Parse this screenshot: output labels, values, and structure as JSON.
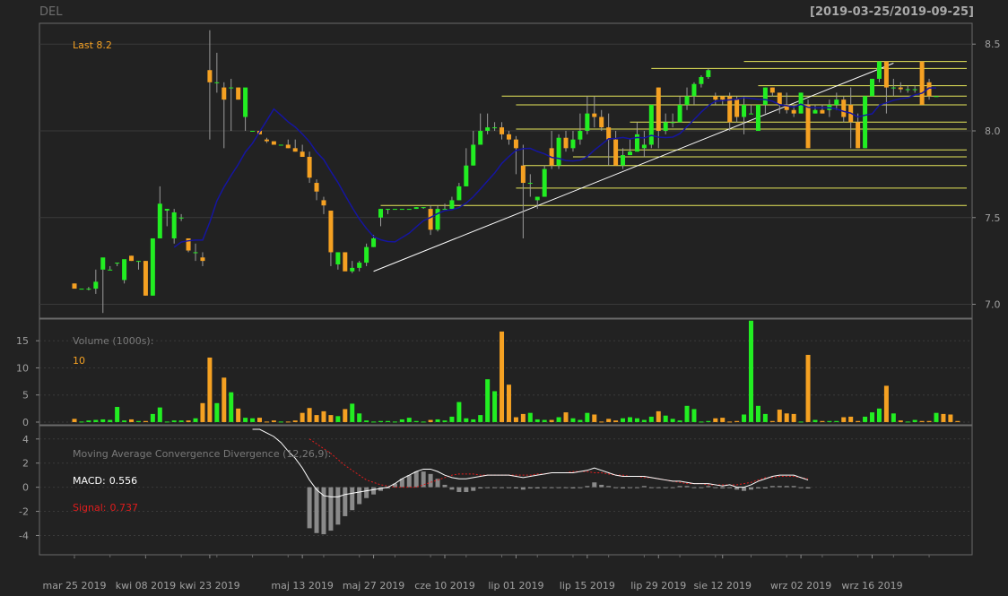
{
  "header": {
    "ticker": "DEL",
    "date_range": "[2019-03-25/2019-09-25]"
  },
  "colors": {
    "background": "#222222",
    "up": "#22ee22",
    "down": "#f5a122",
    "sma": "#1515a0",
    "level_line": "#e6e65a",
    "trend_line": "#ffffff",
    "macd": "#ffffff",
    "signal": "#e01c1c",
    "histogram": "#8a8a8a",
    "grid": "#3a3a3a",
    "text": "#a0a0a0"
  },
  "chart_data": [
    {
      "type": "candlestick",
      "name": "price",
      "last_label": "Last 8.2",
      "y_ticks": [
        "7.0",
        "7.5",
        "8.0",
        "8.5"
      ],
      "ylim": [
        6.92,
        8.62
      ],
      "x_tick_labels": [
        "mar 25 2019",
        "kwi 08 2019",
        "kwi 23 2019",
        "maj 13 2019",
        "maj 27 2019",
        "cze 10 2019",
        "lip 01 2019",
        "lip 15 2019",
        "lip 29 2019",
        "sie 12 2019",
        "wrz 02 2019",
        "wrz 16 2019"
      ],
      "x_tick_index": [
        0,
        10,
        19,
        32,
        42,
        52,
        62,
        72,
        82,
        91,
        102,
        112
      ],
      "candles": [
        {
          "o": 7.12,
          "h": 7.12,
          "l": 7.1,
          "c": 7.09
        },
        {
          "o": 7.09,
          "h": 7.09,
          "l": 7.09,
          "c": 7.09
        },
        {
          "o": 7.09,
          "h": 7.1,
          "l": 7.08,
          "c": 7.09
        },
        {
          "o": 7.09,
          "h": 7.2,
          "l": 7.06,
          "c": 7.13
        },
        {
          "o": 7.2,
          "h": 7.2,
          "l": 6.95,
          "c": 7.27
        },
        {
          "o": 7.2,
          "h": 7.22,
          "l": 7.2,
          "c": 7.2
        },
        {
          "o": 7.24,
          "h": 7.24,
          "l": 7.22,
          "c": 7.24
        },
        {
          "o": 7.14,
          "h": 7.22,
          "l": 7.12,
          "c": 7.26
        },
        {
          "o": 7.28,
          "h": 7.28,
          "l": 7.25,
          "c": 7.25
        },
        {
          "o": 7.25,
          "h": 7.25,
          "l": 7.2,
          "c": 7.25
        },
        {
          "o": 7.25,
          "h": 7.25,
          "l": 7.05,
          "c": 7.05
        },
        {
          "o": 7.05,
          "h": 7.2,
          "l": 7.05,
          "c": 7.38
        },
        {
          "o": 7.38,
          "h": 7.68,
          "l": 7.38,
          "c": 7.58
        },
        {
          "o": 7.54,
          "h": 7.55,
          "l": 7.45,
          "c": 7.55
        },
        {
          "o": 7.38,
          "h": 7.55,
          "l": 7.35,
          "c": 7.53
        },
        {
          "o": 7.5,
          "h": 7.52,
          "l": 7.48,
          "c": 7.5
        },
        {
          "o": 7.38,
          "h": 7.38,
          "l": 7.3,
          "c": 7.31
        },
        {
          "o": 7.3,
          "h": 7.35,
          "l": 7.25,
          "c": 7.3
        },
        {
          "o": 7.27,
          "h": 7.3,
          "l": 7.22,
          "c": 7.25
        },
        {
          "o": 8.35,
          "h": 8.58,
          "l": 7.95,
          "c": 8.28
        },
        {
          "o": 8.28,
          "h": 8.45,
          "l": 8.22,
          "c": 8.28
        },
        {
          "o": 8.25,
          "h": 8.28,
          "l": 7.9,
          "c": 8.18
        },
        {
          "o": 8.25,
          "h": 8.3,
          "l": 8.0,
          "c": 8.25
        },
        {
          "o": 8.25,
          "h": 8.25,
          "l": 8.18,
          "c": 8.18
        },
        {
          "o": 8.08,
          "h": 8.1,
          "l": 8.0,
          "c": 8.25
        },
        {
          "o": 8.0,
          "h": 8.0,
          "l": 8.0,
          "c": 8.0
        },
        {
          "o": 8.0,
          "h": 8.0,
          "l": 7.98,
          "c": 7.98
        },
        {
          "o": 7.95,
          "h": 7.96,
          "l": 7.93,
          "c": 7.94
        },
        {
          "o": 7.94,
          "h": 7.94,
          "l": 7.92,
          "c": 7.92
        },
        {
          "o": 7.92,
          "h": 7.92,
          "l": 7.92,
          "c": 7.92
        },
        {
          "o": 7.92,
          "h": 7.95,
          "l": 7.9,
          "c": 7.9
        },
        {
          "o": 7.9,
          "h": 7.95,
          "l": 7.88,
          "c": 7.88
        },
        {
          "o": 7.88,
          "h": 7.92,
          "l": 7.85,
          "c": 7.85
        },
        {
          "o": 7.85,
          "h": 7.88,
          "l": 7.7,
          "c": 7.73
        },
        {
          "o": 7.7,
          "h": 7.72,
          "l": 7.6,
          "c": 7.65
        },
        {
          "o": 7.6,
          "h": 7.62,
          "l": 7.52,
          "c": 7.57
        },
        {
          "o": 7.54,
          "h": 7.54,
          "l": 7.22,
          "c": 7.3
        },
        {
          "o": 7.23,
          "h": 7.3,
          "l": 7.2,
          "c": 7.3
        },
        {
          "o": 7.3,
          "h": 7.3,
          "l": 7.2,
          "c": 7.19
        },
        {
          "o": 7.19,
          "h": 7.25,
          "l": 7.18,
          "c": 7.21
        },
        {
          "o": 7.21,
          "h": 7.25,
          "l": 7.19,
          "c": 7.24
        },
        {
          "o": 7.24,
          "h": 7.35,
          "l": 7.22,
          "c": 7.33
        },
        {
          "o": 7.33,
          "h": 7.4,
          "l": 7.33,
          "c": 7.38
        },
        {
          "o": 7.5,
          "h": 7.55,
          "l": 7.45,
          "c": 7.55
        },
        {
          "o": 7.55,
          "h": 7.55,
          "l": 7.52,
          "c": 7.55
        },
        {
          "o": 7.55,
          "h": 7.55,
          "l": 7.55,
          "c": 7.55
        },
        {
          "o": 7.55,
          "h": 7.55,
          "l": 7.55,
          "c": 7.55
        },
        {
          "o": 7.55,
          "h": 7.55,
          "l": 7.55,
          "c": 7.55
        },
        {
          "o": 7.55,
          "h": 7.56,
          "l": 7.55,
          "c": 7.56
        },
        {
          "o": 7.56,
          "h": 7.56,
          "l": 7.55,
          "c": 7.56
        },
        {
          "o": 7.55,
          "h": 7.57,
          "l": 7.4,
          "c": 7.43
        },
        {
          "o": 7.43,
          "h": 7.57,
          "l": 7.42,
          "c": 7.55
        },
        {
          "o": 7.55,
          "h": 7.58,
          "l": 7.55,
          "c": 7.55
        },
        {
          "o": 7.55,
          "h": 7.62,
          "l": 7.55,
          "c": 7.6
        },
        {
          "o": 7.6,
          "h": 7.7,
          "l": 7.6,
          "c": 7.68
        },
        {
          "o": 7.68,
          "h": 7.9,
          "l": 7.68,
          "c": 7.8
        },
        {
          "o": 7.8,
          "h": 8.0,
          "l": 7.8,
          "c": 7.92
        },
        {
          "o": 7.92,
          "h": 8.1,
          "l": 7.92,
          "c": 8.0
        },
        {
          "o": 8.0,
          "h": 8.1,
          "l": 7.98,
          "c": 8.02
        },
        {
          "o": 8.02,
          "h": 8.05,
          "l": 8.0,
          "c": 8.02
        },
        {
          "o": 8.02,
          "h": 8.05,
          "l": 7.95,
          "c": 7.98
        },
        {
          "o": 7.98,
          "h": 8.0,
          "l": 7.92,
          "c": 7.95
        },
        {
          "o": 7.95,
          "h": 7.97,
          "l": 7.75,
          "c": 7.9
        },
        {
          "o": 7.8,
          "h": 7.92,
          "l": 7.38,
          "c": 7.7
        },
        {
          "o": 7.7,
          "h": 7.75,
          "l": 7.62,
          "c": 7.7
        },
        {
          "o": 7.6,
          "h": 7.62,
          "l": 7.55,
          "c": 7.62
        },
        {
          "o": 7.62,
          "h": 7.8,
          "l": 7.62,
          "c": 7.78
        },
        {
          "o": 7.9,
          "h": 8.0,
          "l": 7.78,
          "c": 7.8
        },
        {
          "o": 7.8,
          "h": 7.98,
          "l": 7.78,
          "c": 7.96
        },
        {
          "o": 7.96,
          "h": 8.0,
          "l": 7.88,
          "c": 7.9
        },
        {
          "o": 7.9,
          "h": 8.0,
          "l": 7.88,
          "c": 7.95
        },
        {
          "o": 7.95,
          "h": 8.1,
          "l": 7.92,
          "c": 8.0
        },
        {
          "o": 8.0,
          "h": 8.2,
          "l": 7.98,
          "c": 8.1
        },
        {
          "o": 8.1,
          "h": 8.2,
          "l": 8.02,
          "c": 8.08
        },
        {
          "o": 8.08,
          "h": 8.12,
          "l": 8.0,
          "c": 8.02
        },
        {
          "o": 8.02,
          "h": 8.1,
          "l": 7.8,
          "c": 7.95
        },
        {
          "o": 7.95,
          "h": 8.0,
          "l": 7.8,
          "c": 7.8
        },
        {
          "o": 7.8,
          "h": 7.9,
          "l": 7.78,
          "c": 7.86
        },
        {
          "o": 7.86,
          "h": 7.95,
          "l": 7.86,
          "c": 7.88
        },
        {
          "o": 7.88,
          "h": 8.05,
          "l": 7.88,
          "c": 7.98
        },
        {
          "o": 7.9,
          "h": 8.0,
          "l": 7.85,
          "c": 7.92
        },
        {
          "o": 7.92,
          "h": 8.15,
          "l": 7.9,
          "c": 8.15
        },
        {
          "o": 8.25,
          "h": 8.25,
          "l": 7.9,
          "c": 8.0
        },
        {
          "o": 8.0,
          "h": 8.1,
          "l": 7.98,
          "c": 8.05
        },
        {
          "o": 8.05,
          "h": 8.1,
          "l": 8.02,
          "c": 8.05
        },
        {
          "o": 8.05,
          "h": 8.2,
          "l": 8.05,
          "c": 8.15
        },
        {
          "o": 8.15,
          "h": 8.25,
          "l": 8.12,
          "c": 8.2
        },
        {
          "o": 8.2,
          "h": 8.28,
          "l": 8.15,
          "c": 8.27
        },
        {
          "o": 8.27,
          "h": 8.32,
          "l": 8.25,
          "c": 8.31
        },
        {
          "o": 8.31,
          "h": 8.36,
          "l": 8.3,
          "c": 8.35
        },
        {
          "o": 8.2,
          "h": 8.22,
          "l": 8.15,
          "c": 8.18
        },
        {
          "o": 8.2,
          "h": 8.2,
          "l": 8.15,
          "c": 8.18
        },
        {
          "o": 8.2,
          "h": 8.22,
          "l": 8.0,
          "c": 8.05
        },
        {
          "o": 8.18,
          "h": 8.2,
          "l": 8.05,
          "c": 8.08
        },
        {
          "o": 8.08,
          "h": 8.2,
          "l": 7.98,
          "c": 8.15
        },
        {
          "o": 8.1,
          "h": 8.15,
          "l": 8.1,
          "c": 8.1
        },
        {
          "o": 8.0,
          "h": 8.0,
          "l": 8.0,
          "c": 8.15
        },
        {
          "o": 8.15,
          "h": 8.25,
          "l": 8.1,
          "c": 8.25
        },
        {
          "o": 8.25,
          "h": 8.25,
          "l": 8.2,
          "c": 8.22
        },
        {
          "o": 8.22,
          "h": 8.22,
          "l": 8.1,
          "c": 8.15
        },
        {
          "o": 8.15,
          "h": 8.22,
          "l": 8.1,
          "c": 8.12
        },
        {
          "o": 8.12,
          "h": 8.15,
          "l": 8.08,
          "c": 8.1
        },
        {
          "o": 8.1,
          "h": 8.22,
          "l": 8.1,
          "c": 8.22
        },
        {
          "o": 8.15,
          "h": 8.18,
          "l": 7.9,
          "c": 7.9
        },
        {
          "o": 8.1,
          "h": 8.15,
          "l": 8.1,
          "c": 8.12
        },
        {
          "o": 8.12,
          "h": 8.15,
          "l": 8.1,
          "c": 8.1
        },
        {
          "o": 8.12,
          "h": 8.18,
          "l": 8.08,
          "c": 8.15
        },
        {
          "o": 8.15,
          "h": 8.22,
          "l": 8.12,
          "c": 8.18
        },
        {
          "o": 8.18,
          "h": 8.2,
          "l": 8.05,
          "c": 8.08
        },
        {
          "o": 8.15,
          "h": 8.25,
          "l": 7.9,
          "c": 8.05
        },
        {
          "o": 8.05,
          "h": 8.1,
          "l": 7.9,
          "c": 7.9
        },
        {
          "o": 7.9,
          "h": 8.2,
          "l": 7.9,
          "c": 8.2
        },
        {
          "o": 8.2,
          "h": 8.3,
          "l": 8.2,
          "c": 8.3
        },
        {
          "o": 8.3,
          "h": 8.4,
          "l": 8.28,
          "c": 8.4
        },
        {
          "o": 8.4,
          "h": 8.4,
          "l": 8.1,
          "c": 8.25
        },
        {
          "o": 8.25,
          "h": 8.3,
          "l": 8.2,
          "c": 8.25
        },
        {
          "o": 8.25,
          "h": 8.28,
          "l": 8.22,
          "c": 8.24
        },
        {
          "o": 8.24,
          "h": 8.26,
          "l": 8.22,
          "c": 8.24
        },
        {
          "o": 8.24,
          "h": 8.26,
          "l": 8.22,
          "c": 8.24
        },
        {
          "o": 8.4,
          "h": 8.4,
          "l": 8.15,
          "c": 8.15
        },
        {
          "o": 8.28,
          "h": 8.3,
          "l": 8.18,
          "c": 8.2
        },
        {
          "o": 8.2,
          "h": 8.2,
          "l": 8.2,
          "c": 8.2
        }
      ],
      "sma_start_index": 14,
      "horizontal_levels": [
        {
          "y": 8.4,
          "from": 94,
          "to": 124
        },
        {
          "y": 8.36,
          "from": 81,
          "to": 124
        },
        {
          "y": 8.26,
          "from": 96,
          "to": 124
        },
        {
          "y": 8.2,
          "from": 60,
          "to": 124
        },
        {
          "y": 8.15,
          "from": 62,
          "to": 124
        },
        {
          "y": 8.05,
          "from": 78,
          "to": 124
        },
        {
          "y": 8.01,
          "from": 62,
          "to": 124
        },
        {
          "y": 7.89,
          "from": 76,
          "to": 124
        },
        {
          "y": 7.85,
          "from": 70,
          "to": 124
        },
        {
          "y": 7.8,
          "from": 63,
          "to": 124
        },
        {
          "y": 7.67,
          "from": 62,
          "to": 124
        },
        {
          "y": 7.57,
          "from": 43,
          "to": 124
        }
      ],
      "trend_line": {
        "from_index": 42,
        "from_value": 7.19,
        "to_index": 115,
        "to_value": 8.39
      }
    },
    {
      "type": "bar",
      "name": "volume",
      "title": "Volume (1000s):",
      "last_value": "10",
      "y_ticks": [
        "0",
        "5",
        "10",
        "15"
      ],
      "ylim": [
        -0.5,
        19
      ],
      "values": [
        0.6,
        0.1,
        0.3,
        0.4,
        0.5,
        0.4,
        2.8,
        0.3,
        0.5,
        0.2,
        0.2,
        1.5,
        2.7,
        0.1,
        0.3,
        0.3,
        0.3,
        0.7,
        3.5,
        11.9,
        3.5,
        8.2,
        5.5,
        2.5,
        0.8,
        0.7,
        0.8,
        0.1,
        0.3,
        0.1,
        0.1,
        0.3,
        1.7,
        2.6,
        1.3,
        2.0,
        1.3,
        1.1,
        2.4,
        3.4,
        1.6,
        0.3,
        0.1,
        0.2,
        0.2,
        0.1,
        0.5,
        0.8,
        0.2,
        0.1,
        0.4,
        0.5,
        0.3,
        1.0,
        3.7,
        0.7,
        0.5,
        1.3,
        7.9,
        5.7,
        16.7,
        6.9,
        0.9,
        1.5,
        1.7,
        0.5,
        0.4,
        0.4,
        0.9,
        1.8,
        0.7,
        0.4,
        1.7,
        1.4,
        0.1,
        0.6,
        0.3,
        0.7,
        0.9,
        0.7,
        0.4,
        1.0,
        2.0,
        1.2,
        0.6,
        0.3,
        3.0,
        2.4,
        0.1,
        0.2,
        0.7,
        0.8,
        0.1,
        0.2,
        1.4,
        18.7,
        3.0,
        1.5,
        0.2,
        2.3,
        1.6,
        1.5,
        0.1,
        12.4,
        0.4,
        0.2,
        0.2,
        0.2,
        0.9,
        1.0,
        0.2,
        1.0,
        1.8,
        2.5,
        6.7,
        1.6,
        0.3,
        0.1,
        0.4,
        0.2,
        0.2,
        1.7,
        1.5,
        1.4,
        0.2
      ],
      "colors_note": "bar color follows candle direction"
    },
    {
      "type": "line",
      "name": "macd",
      "title": "Moving Average Convergence Divergence (12,26,9):",
      "macd_label": "MACD:",
      "macd_value": "0.556",
      "signal_label": "Signal:",
      "signal_value": "0.737",
      "y_ticks": [
        "4",
        "2",
        "0",
        "-2",
        "-4"
      ],
      "ylim": [
        -5.6,
        5.1
      ],
      "macd_start_index": 25,
      "signal_start_index": 33,
      "macd": [
        4.8,
        4.8,
        4.5,
        4.2,
        3.7,
        3.0,
        2.4,
        1.6,
        0.6,
        -0.2,
        -0.7,
        -0.8,
        -0.8,
        -0.6,
        -0.5,
        -0.4,
        -0.3,
        -0.2,
        -0.1,
        0.0,
        0.3,
        0.7,
        1.0,
        1.3,
        1.5,
        1.5,
        1.3,
        1.0,
        0.8,
        0.7,
        0.7,
        0.8,
        0.9,
        1.0,
        1.0,
        1.0,
        1.0,
        0.9,
        0.8,
        0.9,
        1.0,
        1.1,
        1.2,
        1.2,
        1.2,
        1.2,
        1.3,
        1.4,
        1.6,
        1.4,
        1.2,
        1.0,
        0.9,
        0.9,
        0.9,
        0.9,
        0.8,
        0.7,
        0.6,
        0.5,
        0.5,
        0.4,
        0.3,
        0.3,
        0.3,
        0.2,
        0.1,
        0.2,
        0.0,
        0.0,
        0.2,
        0.5,
        0.7,
        0.9,
        1.0,
        1.0,
        1.0,
        0.8,
        0.6
      ],
      "signal": [
        4.0,
        3.6,
        3.2,
        2.8,
        2.3,
        1.8,
        1.4,
        1.0,
        0.6,
        0.4,
        0.2,
        0.1,
        0.0,
        0.0,
        0.0,
        0.0,
        0.2,
        0.4,
        0.6,
        0.8,
        1.0,
        1.1,
        1.1,
        1.1,
        1.0,
        1.0,
        1.0,
        1.0,
        1.0,
        1.0,
        1.0,
        1.0,
        1.1,
        1.1,
        1.2,
        1.2,
        1.2,
        1.3,
        1.3,
        1.3,
        1.2,
        1.2,
        1.1,
        1.0,
        1.0,
        0.9,
        0.9,
        0.8,
        0.8,
        0.7,
        0.6,
        0.5,
        0.4,
        0.3,
        0.3,
        0.3,
        0.2,
        0.2,
        0.2,
        0.2,
        0.2,
        0.3,
        0.4,
        0.6,
        0.8,
        0.8,
        0.9,
        0.9,
        0.9,
        0.8,
        0.7
      ]
    }
  ]
}
